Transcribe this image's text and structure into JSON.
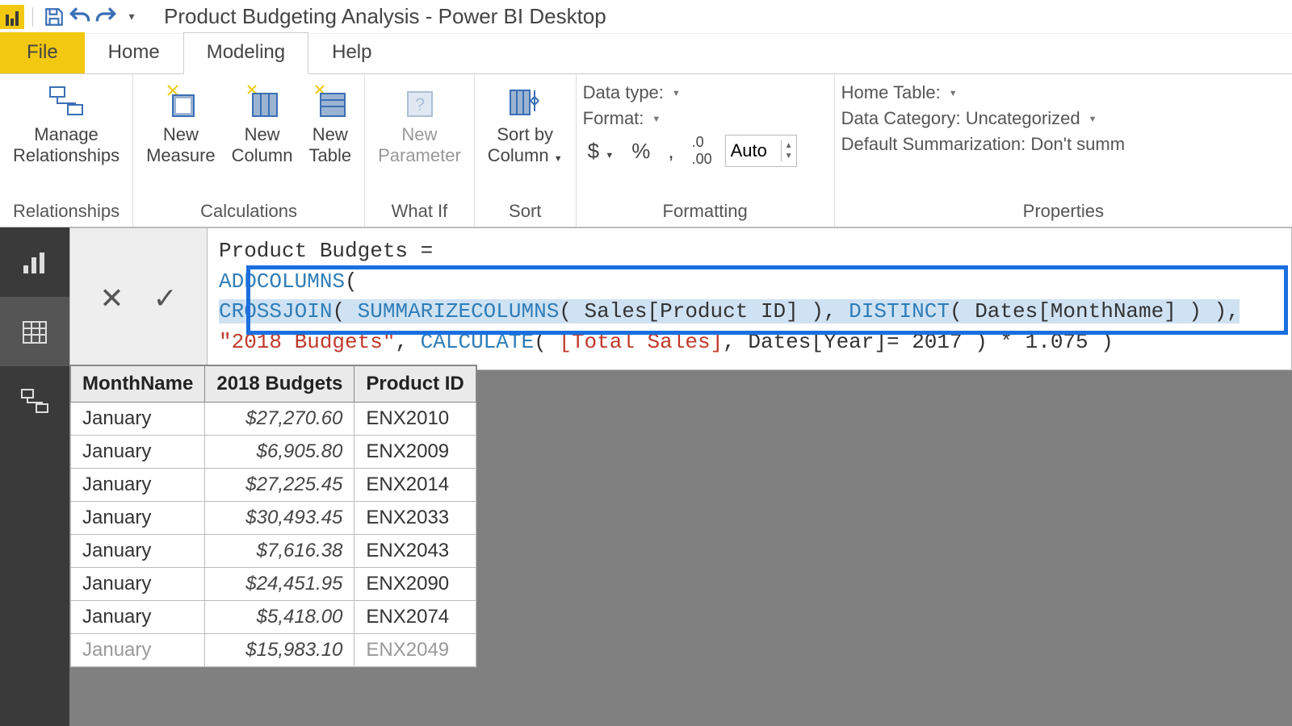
{
  "title": "Product Budgeting Analysis - Power BI Desktop",
  "menu": {
    "file": "File",
    "home": "Home",
    "modeling": "Modeling",
    "help": "Help"
  },
  "ribbon": {
    "relationships": {
      "manage": "Manage\nRelationships",
      "group": "Relationships"
    },
    "calculations": {
      "newMeasure": "New\nMeasure",
      "newColumn": "New\nColumn",
      "newTable": "New\nTable",
      "group": "Calculations"
    },
    "whatif": {
      "newParam": "New\nParameter",
      "group": "What If"
    },
    "sort": {
      "sortBy": "Sort by\nColumn",
      "group": "Sort"
    },
    "formatting": {
      "dataType": "Data type:",
      "format": "Format:",
      "auto": "Auto",
      "group": "Formatting"
    },
    "properties": {
      "homeTable": "Home Table:",
      "dataCategory": "Data Category: Uncategorized",
      "defaultSumm": "Default Summarization: Don't summ",
      "group": "Properties"
    }
  },
  "formula": {
    "line1a": "Product Budgets =",
    "line2_fn": "ADDCOLUMNS",
    "line2_rest": "(",
    "line3_pre": "    ",
    "line3_cross": "CROSSJOIN",
    "line3_p1": "( ",
    "line3_summ": "SUMMARIZECOLUMNS",
    "line3_p2": "( Sales[Product ID] ), ",
    "line3_dist": "DISTINCT",
    "line3_p3": "( Dates[MonthName] ) ),",
    "line4_pre": "        ",
    "line4_str": "\"2018 Budgets\"",
    "line4_mid": ", ",
    "line4_calc": "CALCULATE",
    "line4_p1": "( ",
    "line4_meas": "[Total Sales]",
    "line4_p2": ", Dates[Year]= 2017 ) * 1.075 )"
  },
  "table": {
    "headers": [
      "MonthName",
      "2018 Budgets",
      "Product ID"
    ],
    "rows": [
      [
        "January",
        "$27,270.60",
        "ENX2010"
      ],
      [
        "January",
        "$6,905.80",
        "ENX2009"
      ],
      [
        "January",
        "$27,225.45",
        "ENX2014"
      ],
      [
        "January",
        "$30,493.45",
        "ENX2033"
      ],
      [
        "January",
        "$7,616.38",
        "ENX2043"
      ],
      [
        "January",
        "$24,451.95",
        "ENX2090"
      ],
      [
        "January",
        "$5,418.00",
        "ENX2074"
      ],
      [
        "January",
        "$15,983.10",
        "ENX2049"
      ]
    ]
  }
}
